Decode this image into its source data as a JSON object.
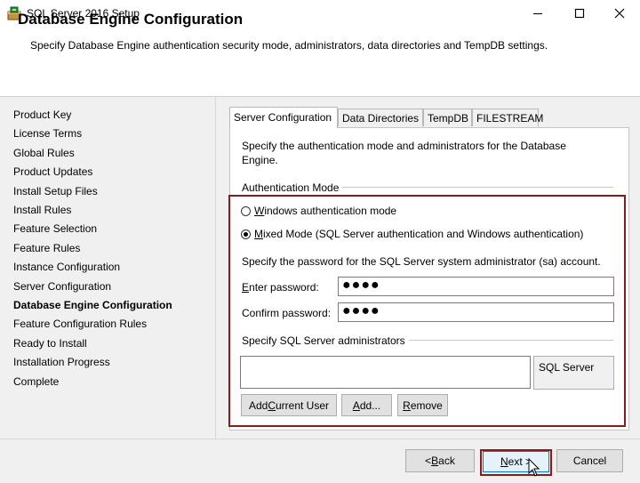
{
  "window": {
    "title": "SQL Server 2016 Setup",
    "minimize_glyph": "minimize-icon",
    "maximize_glyph": "maximize-icon",
    "close_glyph": "close-icon"
  },
  "header": {
    "title": "Database Engine Configuration",
    "description": "Specify Database Engine authentication security mode, administrators, data directories and TempDB settings."
  },
  "nav": {
    "items": [
      "Product Key",
      "License Terms",
      "Global Rules",
      "Product Updates",
      "Install Setup Files",
      "Install Rules",
      "Feature Selection",
      "Feature Rules",
      "Instance Configuration",
      "Server Configuration",
      "Database Engine Configuration",
      "Feature Configuration Rules",
      "Ready to Install",
      "Installation Progress",
      "Complete"
    ],
    "active_index": 10
  },
  "tabs": [
    "Server Configuration",
    "Data Directories",
    "TempDB",
    "FILESTREAM"
  ],
  "panel": {
    "description": "Specify the authentication mode and administrators for the Database Engine.",
    "group_label": "Authentication Mode",
    "windows_auth": {
      "mnemonic": "W",
      "rest": "indows authentication mode",
      "checked": false
    },
    "mixed_mode": {
      "mnemonic": "M",
      "rest": "ixed Mode (SQL Server authentication and Windows authentication)",
      "checked": true
    },
    "sa_prompt": "Specify the password for the SQL Server system administrator (sa) account.",
    "enter_password": {
      "mnemonic": "E",
      "rest": "nter password:",
      "value": "●●●●"
    },
    "confirm_password": {
      "label": "Confirm password:",
      "value": "●●●●"
    },
    "admins_label": "Specify SQL Server administrators",
    "admins_side_text": "SQL Server",
    "add_current_user": {
      "pre": "Add ",
      "mnemonic": "C",
      "post": "urrent User"
    },
    "add": {
      "pre": "",
      "mnemonic": "A",
      "post": "dd..."
    },
    "remove": {
      "pre": "",
      "mnemonic": "R",
      "post": "emove"
    }
  },
  "footer": {
    "back": {
      "pre": "< ",
      "mnemonic": "B",
      "post": "ack"
    },
    "next": {
      "pre": "",
      "mnemonic": "N",
      "post": "ext >"
    },
    "cancel": "Cancel"
  },
  "colors": {
    "highlight_border": "#8b1a1a"
  }
}
